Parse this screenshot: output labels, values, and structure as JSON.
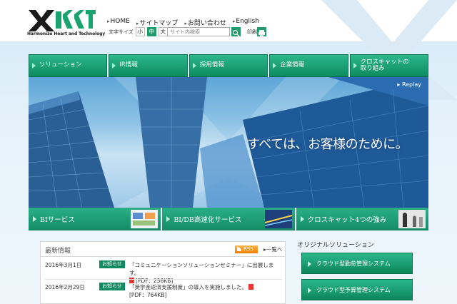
{
  "header": {
    "logo_tagline": "Harmonize Heart and Technology",
    "topnav": [
      "HOME",
      "サイトマップ",
      "お問い合わせ",
      "English"
    ],
    "fontsize_label": "文字サイズ",
    "fontsize_options": [
      "小",
      "中",
      "大"
    ],
    "search_placeholder": "サイト内検索",
    "print_label": "印刷"
  },
  "mainnav": {
    "tabs": [
      "ソリューション",
      "IR情報",
      "採用情報",
      "企業情報",
      "クロスキャットの\n取り組み"
    ]
  },
  "hero": {
    "replay": "Replay",
    "tagline": "すべては、お客様のために。"
  },
  "banners": [
    "BIサービス",
    "BI/DB高速化サービス",
    "クロスキャット4つの強み"
  ],
  "news": {
    "title": "最新情報",
    "rss": "RSS",
    "more": "一覧へ",
    "items": [
      {
        "date": "2016年3月1日",
        "badge": "お知らせ",
        "text": "「コミュニケーションソリューションセミナー」に出展します。",
        "pdf": "[PDF：256KB]"
      },
      {
        "date": "2016年2月29日",
        "badge": "お知らせ",
        "text": "「奨学金返済支援制度」の導入を実施しました。",
        "pdf": "[PDF：764KB]"
      }
    ]
  },
  "solutions": {
    "title": "オリジナルソリューション",
    "items": [
      "クラウド型勤怠管理システム",
      "クラウド型予算管理システム"
    ]
  },
  "colors": {
    "brand_green": "#0f8b61",
    "accent_light": "#2bb88a",
    "rss_orange": "#f07d00"
  }
}
